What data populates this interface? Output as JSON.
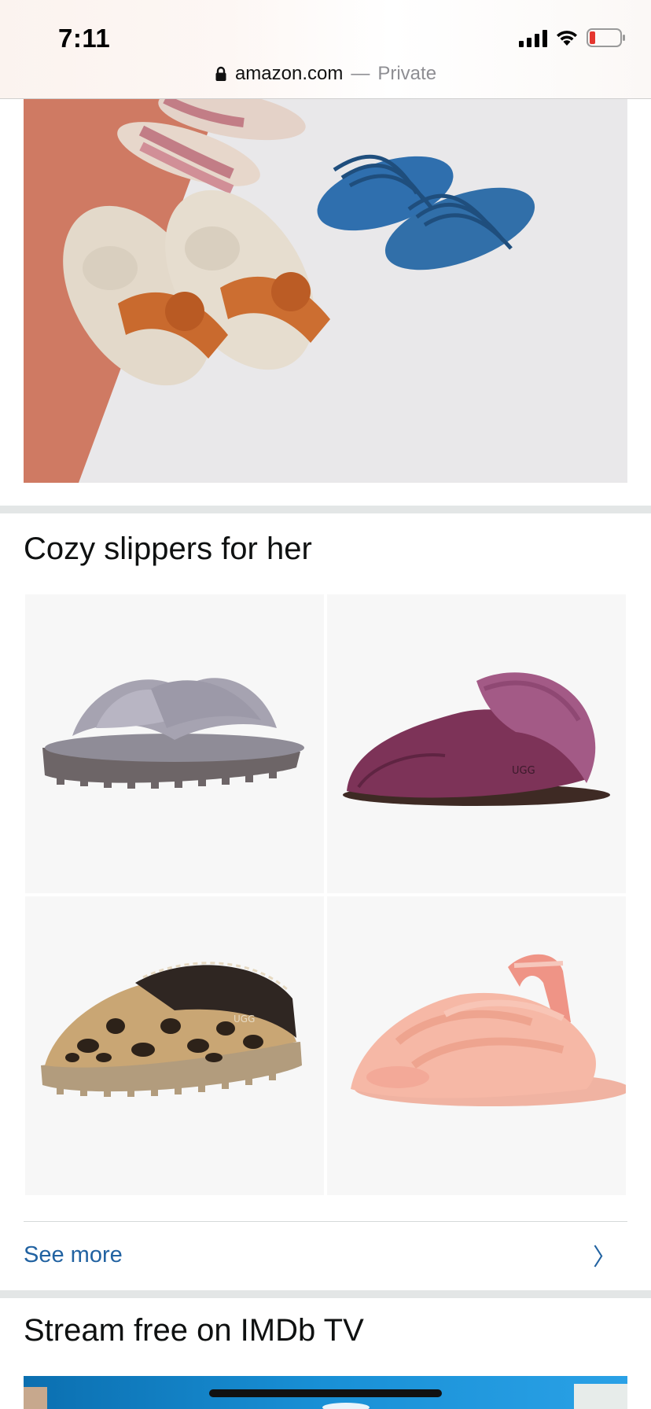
{
  "status_bar": {
    "time": "7:11",
    "battery_color": "#e5362f"
  },
  "url_bar": {
    "domain": "amazon.com",
    "separator": "—",
    "mode": "Private"
  },
  "hero": {
    "image": "sandals-banner"
  },
  "sections": [
    {
      "title": "Cozy slippers for her",
      "products": [
        {
          "name": "grey-crisscross-fur-slide",
          "icon": "slipper-image"
        },
        {
          "name": "purple-suede-scuff-slipper",
          "icon": "slipper-image"
        },
        {
          "name": "leopard-print-slipper",
          "icon": "slipper-image"
        },
        {
          "name": "pink-fluffy-slide",
          "icon": "slipper-image"
        }
      ],
      "see_more": "See more",
      "see_more_chevron": "〉"
    },
    {
      "title": "Stream free on IMDb TV"
    }
  ],
  "colors": {
    "link": "#2162a1",
    "divider": "#e3e6e6",
    "tile_bg": "#f7f7f7"
  }
}
